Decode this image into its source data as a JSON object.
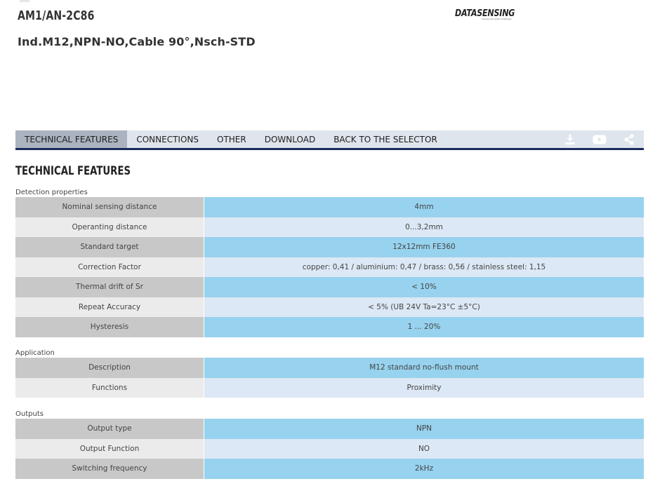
{
  "header": {
    "product_code": "AM1/AN-2C86",
    "product_description": "Ind.M12,NPN-NO,Cable 90°,Nsch-STD",
    "logo_text": "DATASENSING",
    "logo_tagline": "sensing and solution challenges"
  },
  "tabs": [
    {
      "label": "TECHNICAL FEATURES",
      "active": true
    },
    {
      "label": "CONNECTIONS",
      "active": false
    },
    {
      "label": "OTHER",
      "active": false
    },
    {
      "label": "DOWNLOAD",
      "active": false
    },
    {
      "label": "BACK TO THE SELECTOR",
      "active": false
    }
  ],
  "tab_icons": [
    "download-icon",
    "youtube-icon",
    "share-icon"
  ],
  "section_title": "TECHNICAL FEATURES",
  "groups": {
    "detection": {
      "title": "Detection properties",
      "rows": [
        {
          "label": "Nominal sensing distance",
          "value": "4mm"
        },
        {
          "label": "Operanting distance",
          "value": "0...3,2mm"
        },
        {
          "label": "Standard target",
          "value": "12x12mm FE360"
        },
        {
          "label": "Correction Factor",
          "value": "copper: 0,41 / aluminium: 0,47 / brass: 0,56 / stainless steel: 1,15"
        },
        {
          "label": "Thermal drift of Sr",
          "value": "< 10%"
        },
        {
          "label": "Repeat Accuracy",
          "value": "< 5% (UB 24V Ta=23°C ±5°C)"
        },
        {
          "label": "Hysteresis",
          "value": "1 ... 20%"
        }
      ]
    },
    "application": {
      "title": "Application",
      "rows": [
        {
          "label": "Description",
          "value": "M12 standard no-flush mount"
        },
        {
          "label": "Functions",
          "value": "Proximity"
        }
      ]
    },
    "outputs": {
      "title": "Outputs",
      "rows": [
        {
          "label": "Output type",
          "value": "NPN"
        },
        {
          "label": "Output Function",
          "value": "NO"
        },
        {
          "label": "Switching frequency",
          "value": "2kHz"
        }
      ]
    }
  },
  "colors": {
    "nav_underline": "#1a2a5e",
    "tab_bar_bg": "#dfe5ed",
    "active_tab_bg": "#aab3bf",
    "row_value_light": "#dce8f5",
    "row_value_dark": "#97d2ee",
    "row_label_light": "#ebebeb",
    "row_label_dark": "#c8c8c8"
  }
}
